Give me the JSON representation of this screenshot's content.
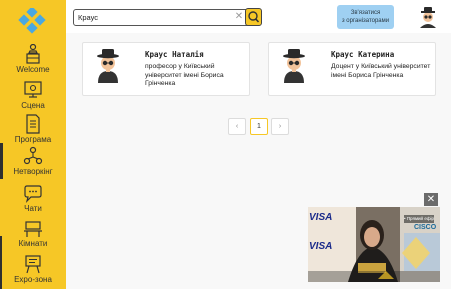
{
  "sidebar": {
    "items": [
      {
        "label": "Welcome",
        "icon": "podium-icon"
      },
      {
        "label": "Сцена",
        "icon": "stage-screen-icon"
      },
      {
        "label": "Програма",
        "icon": "document-icon"
      },
      {
        "label": "Нетворкінг",
        "icon": "networking-icon"
      },
      {
        "label": "Чати",
        "icon": "chat-icon"
      },
      {
        "label": "Кімнати",
        "icon": "room-table-icon"
      },
      {
        "label": "Expo-зона",
        "icon": "expo-board-icon"
      }
    ]
  },
  "header": {
    "search_value": "Краус",
    "clear_label": "✕",
    "contact_line1": "Зв'язатися",
    "contact_line2": "з організаторами"
  },
  "results": [
    {
      "name": "Краус Наталія",
      "description": "професор у Київський університет імені Бориса Грінченка"
    },
    {
      "name": "Краус Катерина",
      "description": "Доцент у Київський університет імені Бориса Грінченка"
    }
  ],
  "pagination": {
    "prev": "‹",
    "current": "1",
    "next": "›"
  },
  "video": {
    "close_label": "✕",
    "brand_text": "VISA",
    "partner_text": "CISCO",
    "live_label": "• Прямий ефір"
  },
  "colors": {
    "brand_yellow": "#f6c726",
    "contact_blue": "#9fd0f2",
    "logo_blue": "#4aa8e0"
  }
}
